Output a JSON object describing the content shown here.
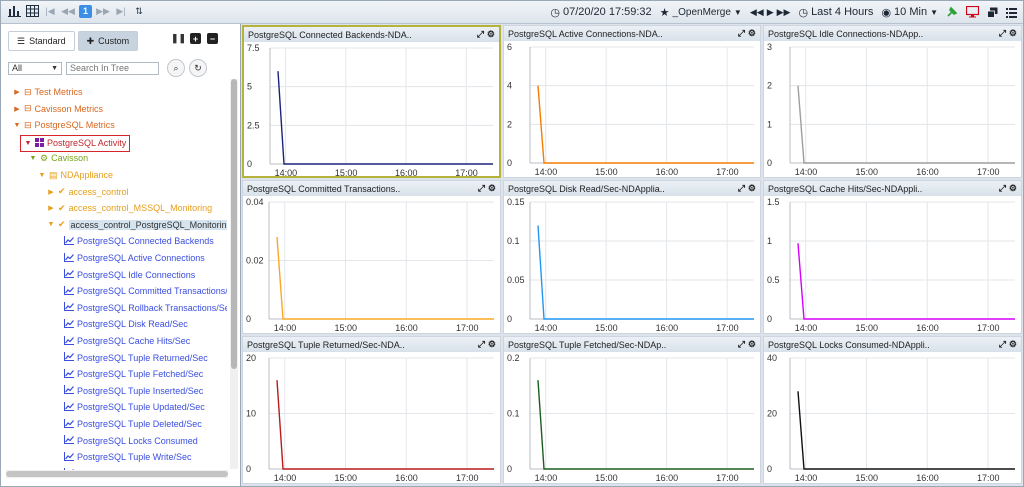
{
  "toolbar": {
    "datetime": "07/20/20 17:59:32",
    "page_number": "1",
    "favorite_label": "_OpenMerge",
    "time_range": "Last 4 Hours",
    "interval": "10 Min"
  },
  "left_panel": {
    "tab_standard": "Standard",
    "tab_custom": "Custom",
    "filter_value": "All",
    "search_placeholder": "Search In Tree",
    "tree": [
      {
        "label": "Test Metrics",
        "depth": 0,
        "arrow": "right",
        "icon": "folder-icon",
        "color": "orange"
      },
      {
        "label": "Cavisson Metrics",
        "depth": 0,
        "arrow": "right",
        "icon": "folder-icon",
        "color": "orange"
      },
      {
        "label": "PostgreSQL Metrics",
        "depth": 0,
        "arrow": "down",
        "icon": "folder-icon",
        "color": "orange"
      },
      {
        "label": "PostgreSQL Activity",
        "depth": 1,
        "arrow": "down",
        "icon": "group-icon",
        "color": "red",
        "selected": true
      },
      {
        "label": "Cavisson",
        "depth": 2,
        "arrow": "down",
        "icon": "cogs-icon",
        "color": "green"
      },
      {
        "label": "NDAppliance",
        "depth": 3,
        "arrow": "down",
        "icon": "server-icon",
        "color": "amber"
      },
      {
        "label": "access_control",
        "depth": 4,
        "arrow": "right",
        "icon": "check-icon",
        "color": "amber"
      },
      {
        "label": "access_control_MSSQL_Monitoring",
        "depth": 4,
        "arrow": "right",
        "icon": "check-icon",
        "color": "amber"
      },
      {
        "label": "access_control_PostgreSQL_Monitoring",
        "depth": 4,
        "arrow": "down",
        "icon": "check-icon",
        "color": "amber",
        "highlight": true
      },
      {
        "label": "PostgreSQL Connected Backends",
        "depth": 5,
        "icon": "chart-icon",
        "color": "blue"
      },
      {
        "label": "PostgreSQL Active Connections",
        "depth": 5,
        "icon": "chart-icon",
        "color": "blue"
      },
      {
        "label": "PostgreSQL Idle Connections",
        "depth": 5,
        "icon": "chart-icon",
        "color": "blue"
      },
      {
        "label": "PostgreSQL Committed Transactions/Se",
        "depth": 5,
        "icon": "chart-icon",
        "color": "blue"
      },
      {
        "label": "PostgreSQL Rollback Transactions/Sec",
        "depth": 5,
        "icon": "chart-icon",
        "color": "blue"
      },
      {
        "label": "PostgreSQL Disk Read/Sec",
        "depth": 5,
        "icon": "chart-icon",
        "color": "blue"
      },
      {
        "label": "PostgreSQL Cache Hits/Sec",
        "depth": 5,
        "icon": "chart-icon",
        "color": "blue"
      },
      {
        "label": "PostgreSQL Tuple Returned/Sec",
        "depth": 5,
        "icon": "chart-icon",
        "color": "blue"
      },
      {
        "label": "PostgreSQL Tuple Fetched/Sec",
        "depth": 5,
        "icon": "chart-icon",
        "color": "blue"
      },
      {
        "label": "PostgreSQL Tuple Inserted/Sec",
        "depth": 5,
        "icon": "chart-icon",
        "color": "blue"
      },
      {
        "label": "PostgreSQL Tuple Updated/Sec",
        "depth": 5,
        "icon": "chart-icon",
        "color": "blue"
      },
      {
        "label": "PostgreSQL Tuple Deleted/Sec",
        "depth": 5,
        "icon": "chart-icon",
        "color": "blue"
      },
      {
        "label": "PostgreSQL Locks Consumed",
        "depth": 5,
        "icon": "chart-icon",
        "color": "blue"
      },
      {
        "label": "PostgreSQL Tuple Write/Sec",
        "depth": 5,
        "icon": "chart-icon",
        "color": "blue"
      },
      {
        "label": "PostgreSQL Hit (%)",
        "depth": 5,
        "icon": "chart-icon",
        "color": "blue"
      }
    ]
  },
  "chart_data": [
    {
      "type": "line",
      "title": "PostgreSQL Connected Backends-NDA..",
      "x_ticks": [
        "14:00",
        "15:00",
        "16:00",
        "17:00"
      ],
      "y_ticks": [
        "0",
        "2.5",
        "5",
        "7.5"
      ],
      "ylim": [
        0,
        7.5
      ],
      "color": "#1a237e",
      "peak": 6.0,
      "focused": true
    },
    {
      "type": "line",
      "title": "PostgreSQL Active Connections-NDA..",
      "x_ticks": [
        "14:00",
        "15:00",
        "16:00",
        "17:00"
      ],
      "y_ticks": [
        "0",
        "2",
        "4",
        "6"
      ],
      "ylim": [
        0,
        6
      ],
      "color": "#f57c00",
      "peak": 4.0
    },
    {
      "type": "line",
      "title": "PostgreSQL Idle Connections-NDApp..",
      "x_ticks": [
        "14:00",
        "15:00",
        "16:00",
        "17:00"
      ],
      "y_ticks": [
        "0",
        "1",
        "2",
        "3"
      ],
      "ylim": [
        0,
        3
      ],
      "color": "#9e9e9e",
      "peak": 2.0
    },
    {
      "type": "line",
      "title": "PostgreSQL Committed Transactions..",
      "x_ticks": [
        "14:00",
        "15:00",
        "16:00",
        "17:00"
      ],
      "y_ticks": [
        "0",
        "0.02",
        "0.04"
      ],
      "ylim": [
        0,
        0.04
      ],
      "color": "#f9a825",
      "peak": 0.028
    },
    {
      "type": "line",
      "title": "PostgreSQL Disk Read/Sec-NDApplia..",
      "x_ticks": [
        "14:00",
        "15:00",
        "16:00",
        "17:00"
      ],
      "y_ticks": [
        "0",
        "0.05",
        "0.1",
        "0.15"
      ],
      "ylim": [
        0,
        0.15
      ],
      "color": "#2196f3",
      "peak": 0.12
    },
    {
      "type": "line",
      "title": "PostgreSQL Cache Hits/Sec-NDAppli..",
      "x_ticks": [
        "14:00",
        "15:00",
        "16:00",
        "17:00"
      ],
      "y_ticks": [
        "0",
        "0.5",
        "1",
        "1.5"
      ],
      "ylim": [
        0,
        1.5
      ],
      "color": "#d500f9",
      "peak": 0.97
    },
    {
      "type": "line",
      "title": "PostgreSQL Tuple Returned/Sec-NDA..",
      "x_ticks": [
        "14:00",
        "15:00",
        "16:00",
        "17:00"
      ],
      "y_ticks": [
        "0",
        "10",
        "20"
      ],
      "ylim": [
        0,
        20
      ],
      "color": "#b71c1c",
      "peak": 16
    },
    {
      "type": "line",
      "title": "PostgreSQL Tuple Fetched/Sec-NDAp..",
      "x_ticks": [
        "14:00",
        "15:00",
        "16:00",
        "17:00"
      ],
      "y_ticks": [
        "0",
        "0.1",
        "0.2"
      ],
      "ylim": [
        0,
        0.2
      ],
      "color": "#1b5e20",
      "peak": 0.16
    },
    {
      "type": "line",
      "title": "PostgreSQL Locks Consumed-NDAppli..",
      "x_ticks": [
        "14:00",
        "15:00",
        "16:00",
        "17:00"
      ],
      "y_ticks": [
        "0",
        "20",
        "40"
      ],
      "ylim": [
        0,
        40
      ],
      "color": "#111111",
      "peak": 28
    }
  ]
}
